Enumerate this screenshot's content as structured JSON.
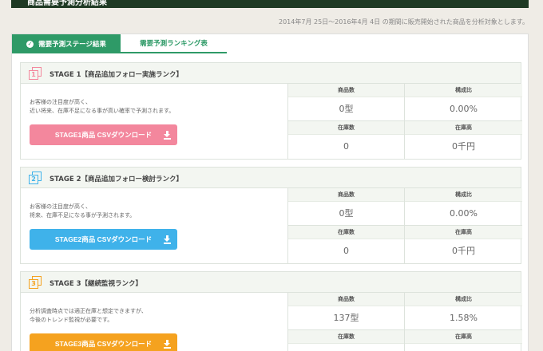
{
  "header": {
    "title": "商品需要予測分析結果",
    "period": "2014年7月 25日〜2016年4月 4日 の期間に販売開始された商品を分析対象とします。"
  },
  "tabs": [
    {
      "label": "需要予測ステージ結果",
      "active": true
    },
    {
      "label": "需要予測ランキング表",
      "active": false
    }
  ],
  "metric_labels": {
    "count": "商品数",
    "ratio": "構成比",
    "stock": "在庫数",
    "stock_value": "在庫高"
  },
  "stages": [
    {
      "number": "1",
      "title": "STAGE 1【商品追加フォロー実施ランク】",
      "desc": [
        "お客様の注目度が高く、",
        "近い将来、在庫不足になる事が高い確率で予測されます。"
      ],
      "button": "STAGE1商品 CSVダウンロード",
      "color": "#f3879d",
      "count": "0型",
      "ratio": "0.00%",
      "stock": "0",
      "stock_value": "0千円"
    },
    {
      "number": "2",
      "title": "STAGE 2【商品追加フォロー検討ランク】",
      "desc": [
        "お客様の注目度が高く、",
        "将来、在庫不足になる事が予測されます。"
      ],
      "button": "STAGE2商品 CSVダウンロード",
      "color": "#3fb2ea",
      "count": "0型",
      "ratio": "0.00%",
      "stock": "0",
      "stock_value": "0千円"
    },
    {
      "number": "3",
      "title": "STAGE 3【継続監視ランク】",
      "desc": [
        "分析調査時点では適正在庫と想定できますが、",
        "今後のトレンド監視が必要です。"
      ],
      "button": "STAGE3商品 CSVダウンロード",
      "color": "#f5a21f",
      "count": "137型",
      "ratio": "1.58%",
      "stock": "",
      "stock_value": ""
    }
  ]
}
